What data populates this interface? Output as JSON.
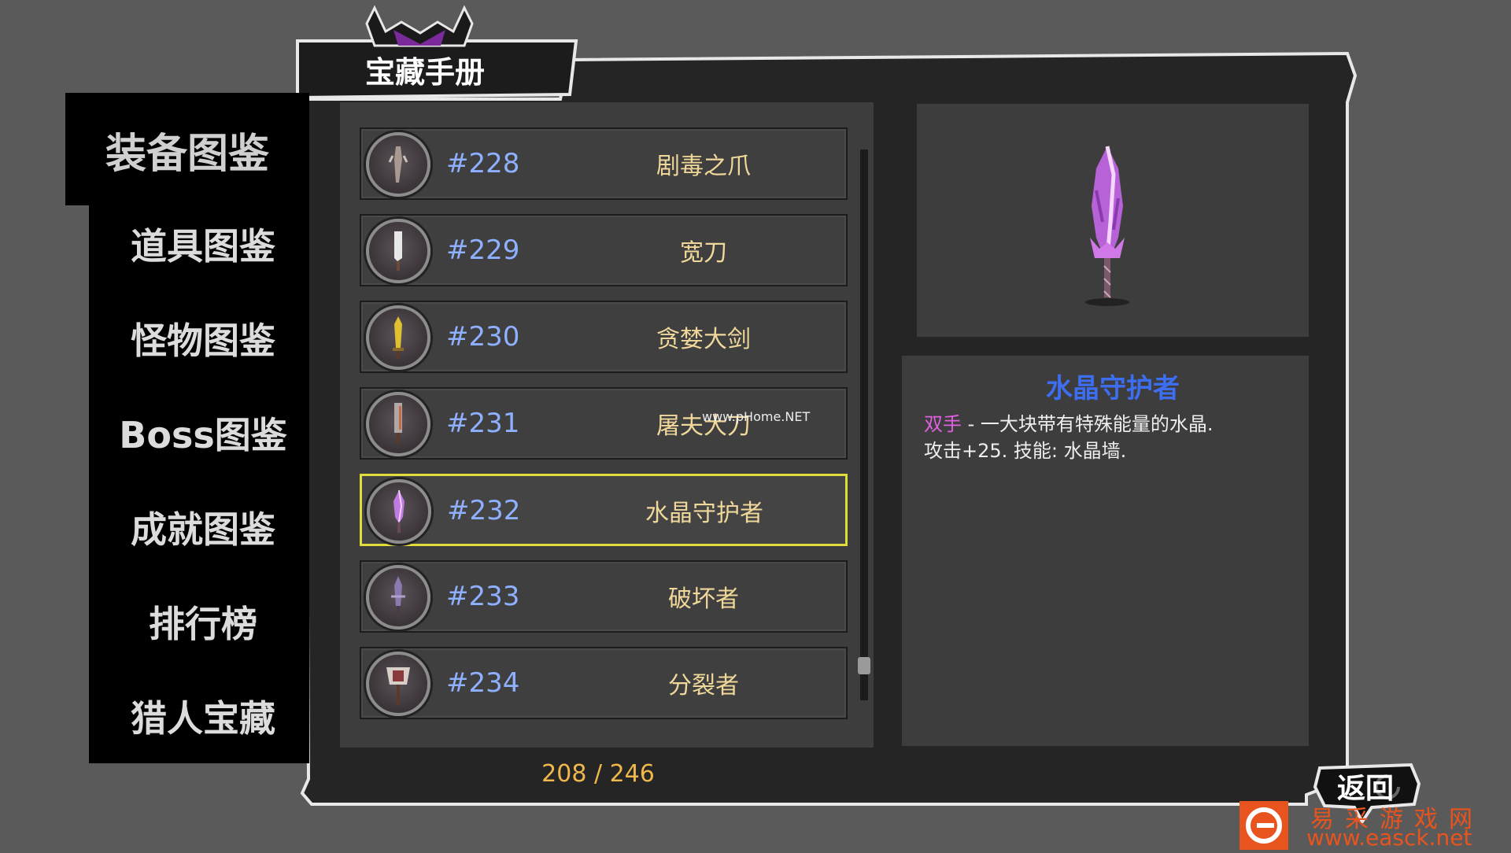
{
  "header": {
    "title": "宝藏手册"
  },
  "sidebar": {
    "items": [
      {
        "label": "装备图鉴",
        "active": true
      },
      {
        "label": "道具图鉴"
      },
      {
        "label": "怪物图鉴"
      },
      {
        "label": "Boss图鉴"
      },
      {
        "label": "成就图鉴"
      },
      {
        "label": "排行榜"
      },
      {
        "label": "猎人宝藏"
      }
    ]
  },
  "list": {
    "rows": [
      {
        "number": "#228",
        "name": "剧毒之爪",
        "icon": "claw-icon"
      },
      {
        "number": "#229",
        "name": "宽刀",
        "icon": "broadsword-icon"
      },
      {
        "number": "#230",
        "name": "贪婪大剑",
        "icon": "golden-greatsword-icon"
      },
      {
        "number": "#231",
        "name": "屠夫大刀",
        "icon": "butcher-blade-icon"
      },
      {
        "number": "#232",
        "name": "水晶守护者",
        "icon": "crystal-sword-icon",
        "selected": true
      },
      {
        "number": "#233",
        "name": "破坏者",
        "icon": "destroyer-sword-icon"
      },
      {
        "number": "#234",
        "name": "分裂者",
        "icon": "axe-icon"
      }
    ],
    "count": "208 / 246",
    "scroll_position": 0.92
  },
  "detail": {
    "title": "水晶守护者",
    "tag": "双手",
    "desc_line1": " - 一大块带有特殊能量的水晶.",
    "desc_line2": "攻击+25. 技能: 水晶墙."
  },
  "back_button": {
    "label": "返回"
  },
  "watermarks": {
    "phome": "www.pHome.NET",
    "easck_cn": "易采游戏网",
    "easck_url": "www.easck.net"
  },
  "colors": {
    "background": "#5a5a5a",
    "panel": "#3d3d3d",
    "selection_border": "#e0dc3a",
    "number": "#8fb0ff",
    "name": "#f0d89a",
    "title_accent": "#3d6df0",
    "tag": "#e060e0",
    "count": "#f0b84a"
  }
}
